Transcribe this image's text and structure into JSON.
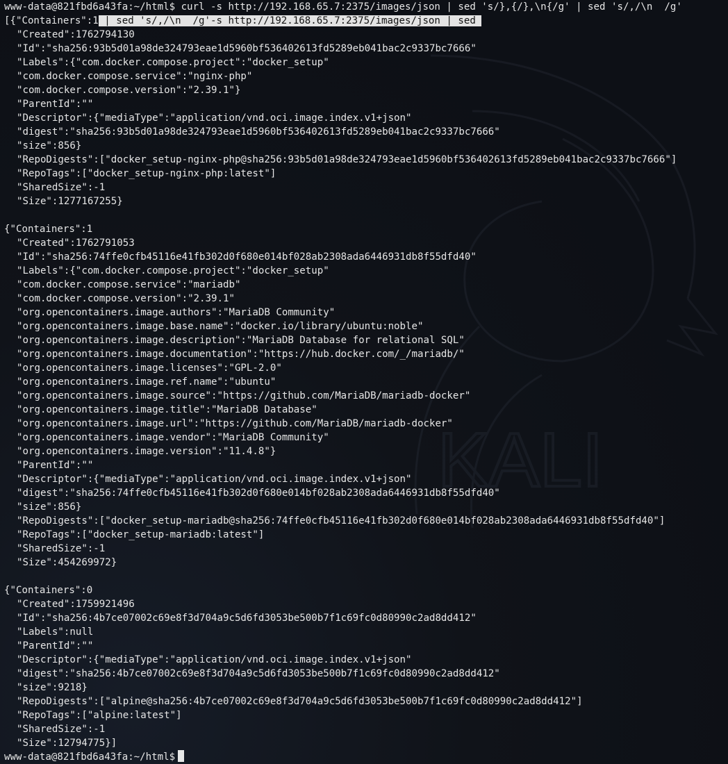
{
  "prompt": "www-data@821fbd6a43fa:~/html$",
  "command_typed": " curl -s http://192.168.65.7:2375/images/json | sed 's/},{/},\\n{/g' | sed 's/,/\\n  /g'",
  "first_line_prefix": "[{\"Containers\":1",
  "first_line_highlight": " | sed 's/,/\\n  /g'-s http://192.168.65.7:2375/images/json | sed ",
  "watermark_text": "KALI",
  "blocks": [
    {
      "lines": [
        "\"Created\":1762794130",
        "\"Id\":\"sha256:93b5d01a98de324793eae1d5960bf536402613fd5289eb041bac2c9337bc7666\"",
        "\"Labels\":{\"com.docker.compose.project\":\"docker_setup\"",
        "\"com.docker.compose.service\":\"nginx-php\"",
        "\"com.docker.compose.version\":\"2.39.1\"}",
        "\"ParentId\":\"\"",
        "\"Descriptor\":{\"mediaType\":\"application/vnd.oci.image.index.v1+json\"",
        "\"digest\":\"sha256:93b5d01a98de324793eae1d5960bf536402613fd5289eb041bac2c9337bc7666\"",
        "\"size\":856}",
        "\"RepoDigests\":[\"docker_setup-nginx-php@sha256:93b5d01a98de324793eae1d5960bf536402613fd5289eb041bac2c9337bc7666\"]",
        "\"RepoTags\":[\"docker_setup-nginx-php:latest\"]",
        "\"SharedSize\":-1",
        "\"Size\":1277167255}"
      ]
    },
    {
      "head": "{\"Containers\":1",
      "lines": [
        "\"Created\":1762791053",
        "\"Id\":\"sha256:74ffe0cfb45116e41fb302d0f680e014bf028ab2308ada6446931db8f55dfd40\"",
        "\"Labels\":{\"com.docker.compose.project\":\"docker_setup\"",
        "\"com.docker.compose.service\":\"mariadb\"",
        "\"com.docker.compose.version\":\"2.39.1\"",
        "\"org.opencontainers.image.authors\":\"MariaDB Community\"",
        "\"org.opencontainers.image.base.name\":\"docker.io/library/ubuntu:noble\"",
        "\"org.opencontainers.image.description\":\"MariaDB Database for relational SQL\"",
        "\"org.opencontainers.image.documentation\":\"https://hub.docker.com/_/mariadb/\"",
        "\"org.opencontainers.image.licenses\":\"GPL-2.0\"",
        "\"org.opencontainers.image.ref.name\":\"ubuntu\"",
        "\"org.opencontainers.image.source\":\"https://github.com/MariaDB/mariadb-docker\"",
        "\"org.opencontainers.image.title\":\"MariaDB Database\"",
        "\"org.opencontainers.image.url\":\"https://github.com/MariaDB/mariadb-docker\"",
        "\"org.opencontainers.image.vendor\":\"MariaDB Community\"",
        "\"org.opencontainers.image.version\":\"11.4.8\"}",
        "\"ParentId\":\"\"",
        "\"Descriptor\":{\"mediaType\":\"application/vnd.oci.image.index.v1+json\"",
        "\"digest\":\"sha256:74ffe0cfb45116e41fb302d0f680e014bf028ab2308ada6446931db8f55dfd40\"",
        "\"size\":856}",
        "\"RepoDigests\":[\"docker_setup-mariadb@sha256:74ffe0cfb45116e41fb302d0f680e014bf028ab2308ada6446931db8f55dfd40\"]",
        "\"RepoTags\":[\"docker_setup-mariadb:latest\"]",
        "\"SharedSize\":-1",
        "\"Size\":454269972}"
      ]
    },
    {
      "head": "{\"Containers\":0",
      "lines": [
        "\"Created\":1759921496",
        "\"Id\":\"sha256:4b7ce07002c69e8f3d704a9c5d6fd3053be500b7f1c69fc0d80990c2ad8dd412\"",
        "\"Labels\":null",
        "\"ParentId\":\"\"",
        "\"Descriptor\":{\"mediaType\":\"application/vnd.oci.image.index.v1+json\"",
        "\"digest\":\"sha256:4b7ce07002c69e8f3d704a9c5d6fd3053be500b7f1c69fc0d80990c2ad8dd412\"",
        "\"size\":9218}",
        "\"RepoDigests\":[\"alpine@sha256:4b7ce07002c69e8f3d704a9c5d6fd3053be500b7f1c69fc0d80990c2ad8dd412\"]",
        "\"RepoTags\":[\"alpine:latest\"]",
        "\"SharedSize\":-1",
        "\"Size\":12794775}]"
      ]
    }
  ],
  "final_prompt": "www-data@821fbd6a43fa:~/html$"
}
